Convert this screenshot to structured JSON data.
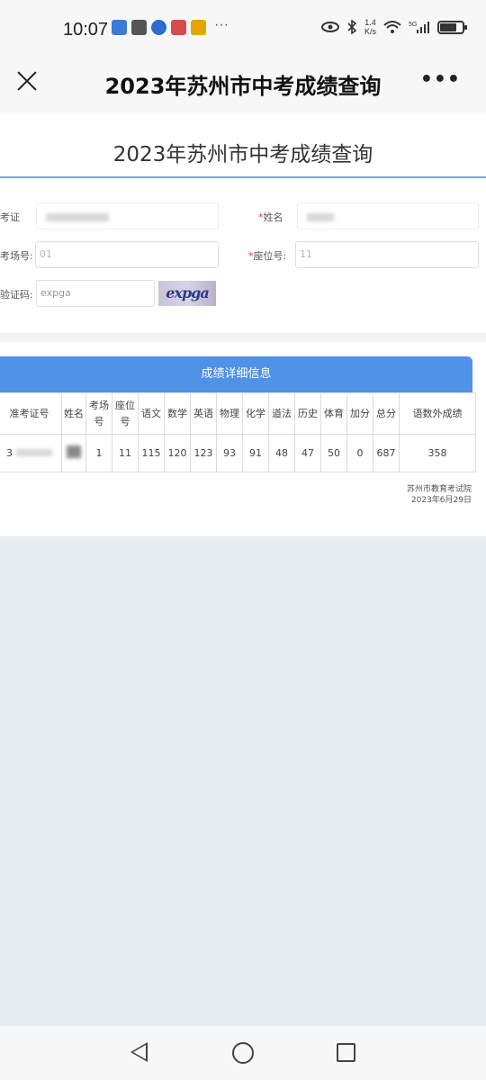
{
  "statusbar": {
    "time": "10:07",
    "net_speed_value": "1.4",
    "net_speed_unit": "K/s",
    "signal": "5G",
    "app_icon_colors": [
      "#3a7bd5",
      "#555555",
      "#2f6bd0",
      "#d94b4b",
      "#e6a400"
    ]
  },
  "nav": {
    "title": "2023年苏州市中考成绩查询",
    "more": "•••"
  },
  "form": {
    "title": "2023年苏州市中考成绩查询",
    "exam_id_label": "考证",
    "name_label": "姓名",
    "room_label": "考场号:",
    "room_placeholder": "01",
    "seat_label": "座位号:",
    "seat_placeholder": "11",
    "captcha_label": "验证码:",
    "captcha_value": "expga",
    "captcha_image_text": "expga",
    "required_mark": "*"
  },
  "results": {
    "header": "成绩详细信息",
    "columns": [
      "准考证号",
      "姓名",
      "考场号",
      "座位号",
      "语文",
      "数学",
      "英语",
      "物理",
      "化学",
      "道法",
      "历史",
      "体育",
      "加分",
      "总分",
      "语数外成绩"
    ],
    "rows": [
      [
        "3",
        "",
        "1",
        "11",
        "115",
        "120",
        "123",
        "93",
        "91",
        "48",
        "47",
        "50",
        "0",
        "687",
        "358"
      ]
    ],
    "footer_org": "苏州市教育考试院",
    "footer_date": "2023年6月29日"
  },
  "colors": {
    "accent": "#4f92e6",
    "divider": "#7ea2d8",
    "required": "#e33333"
  }
}
